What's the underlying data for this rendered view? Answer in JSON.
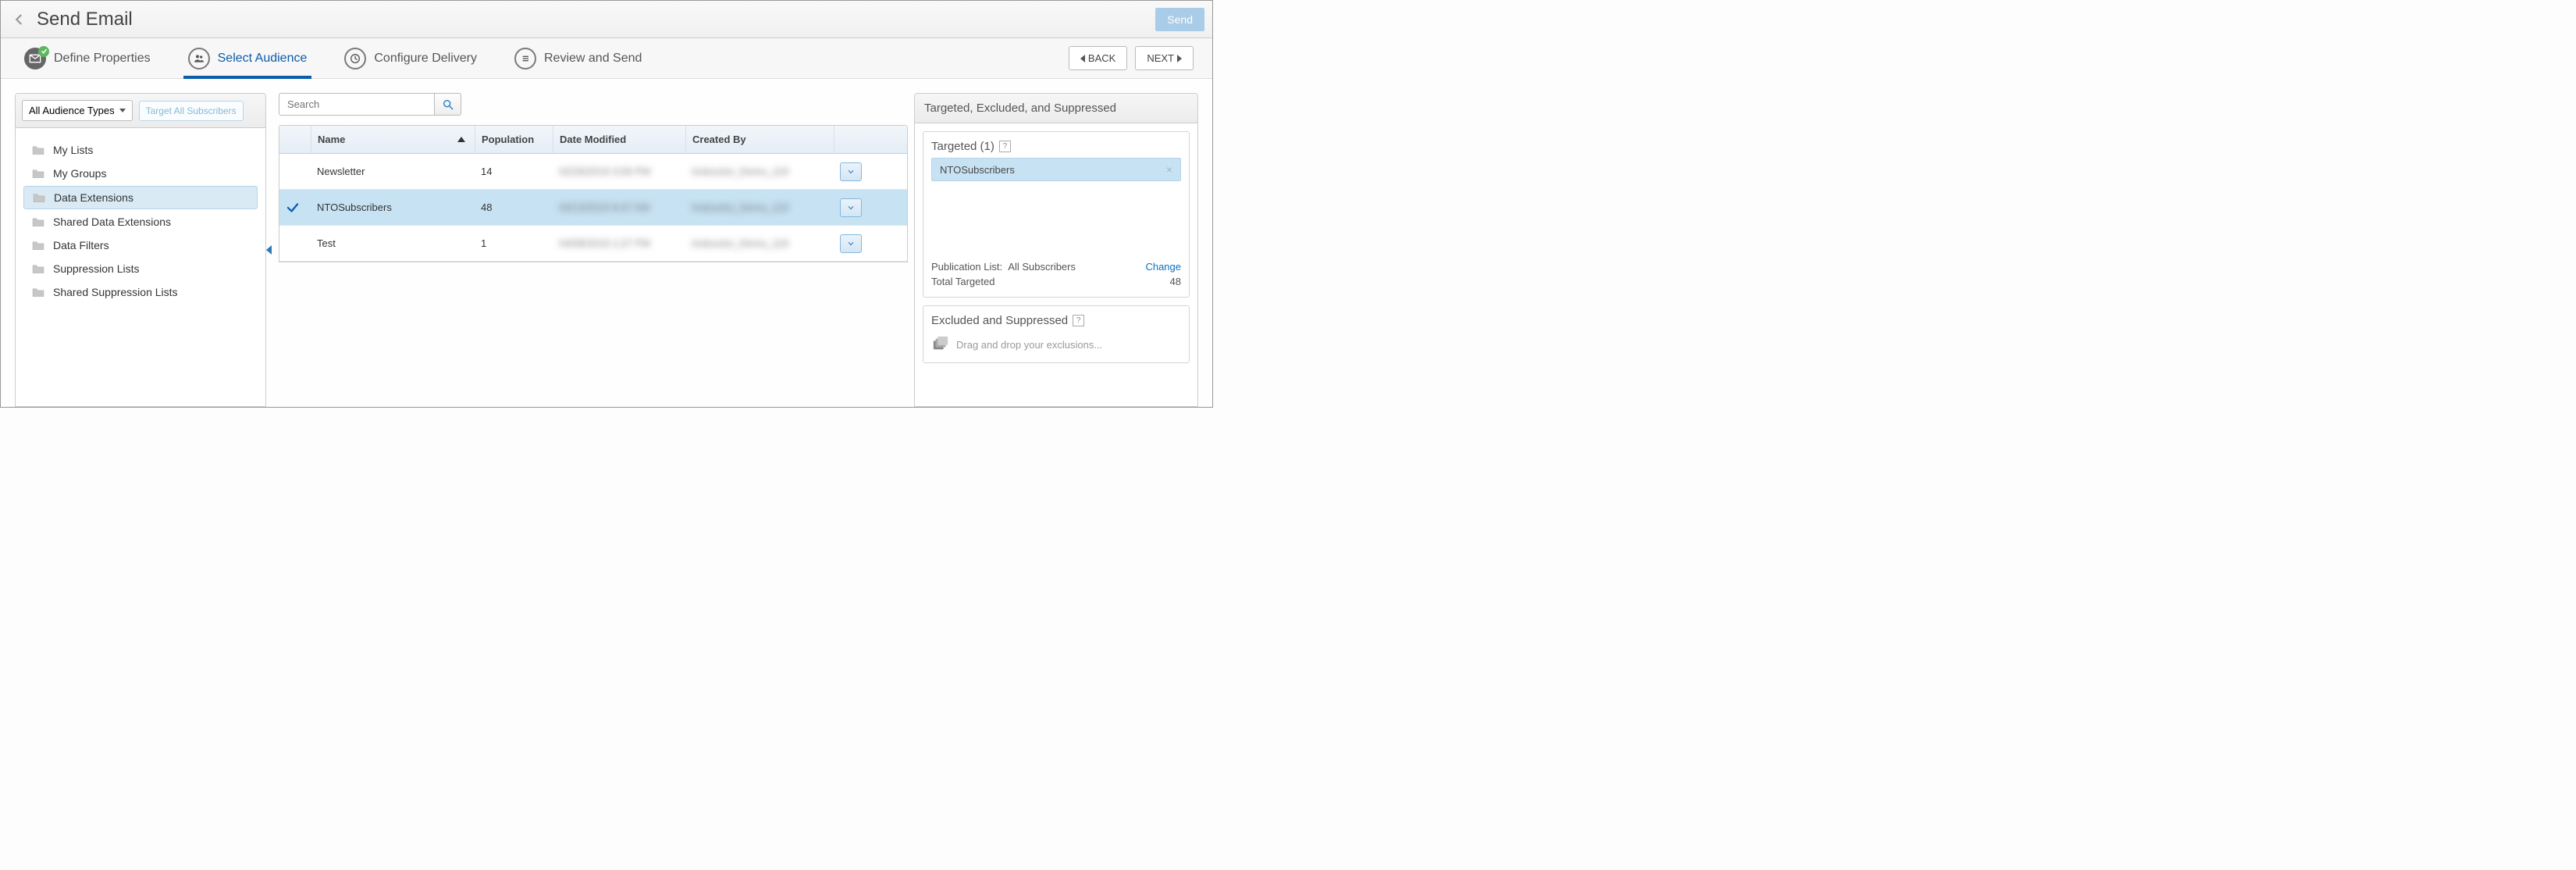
{
  "header": {
    "title": "Send Email",
    "send_label": "Send"
  },
  "steps": {
    "define": "Define Properties",
    "select": "Select Audience",
    "configure": "Configure Delivery",
    "review": "Review and Send",
    "back_label": "BACK",
    "next_label": "NEXT"
  },
  "sidebar": {
    "audience_types_label": "All Audience Types",
    "target_all_label": "Target All Subscribers",
    "folders": [
      "My Lists",
      "My Groups",
      "Data Extensions",
      "Shared Data Extensions",
      "Data Filters",
      "Suppression Lists",
      "Shared Suppression Lists"
    ],
    "selected_index": 2
  },
  "search": {
    "placeholder": "Search"
  },
  "grid": {
    "columns": {
      "name": "Name",
      "population": "Population",
      "date_modified": "Date Modified",
      "created_by": "Created By"
    },
    "rows": [
      {
        "name": "Newsletter",
        "population": "14",
        "date_modified": "02/26/2019 3:06 PM",
        "created_by": "Instructor_Demo_119",
        "selected": false
      },
      {
        "name": "NTOSubscribers",
        "population": "48",
        "date_modified": "04/13/2019 8:47 AM",
        "created_by": "Instructor_Demo_119",
        "selected": true
      },
      {
        "name": "Test",
        "population": "1",
        "date_modified": "04/08/2019 1:27 PM",
        "created_by": "Instructor_Demo_119",
        "selected": false
      }
    ]
  },
  "right": {
    "panel_title": "Targeted, Excluded, and Suppressed",
    "targeted_title": "Targeted (1)",
    "targeted_chip": "NTOSubscribers",
    "publication_label": "Publication List:",
    "publication_value": "All Subscribers",
    "change_label": "Change",
    "total_targeted_label": "Total Targeted",
    "total_targeted_value": "48",
    "excluded_title": "Excluded and Suppressed",
    "excluded_hint": "Drag and drop your exclusions..."
  }
}
